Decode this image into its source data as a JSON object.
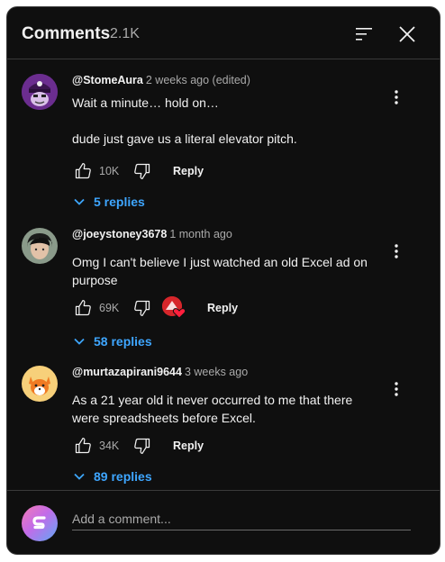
{
  "header": {
    "title": "Comments",
    "count": "2.1K"
  },
  "comments": [
    {
      "author": "@StomeAura",
      "time": "2 weeks ago (edited)",
      "lines": [
        "Wait a minute… hold on…",
        "",
        "dude just gave us a literal elevator pitch."
      ],
      "likes": "10K",
      "reply_label": "Reply",
      "replies_label": "5 replies",
      "creator_heart": false
    },
    {
      "author": "@joeystoney3678",
      "time": "1 month ago",
      "lines": [
        "Omg I can't believe I just watched an old Excel ad on purpose"
      ],
      "likes": "69K",
      "reply_label": "Reply",
      "replies_label": "58 replies",
      "creator_heart": true
    },
    {
      "author": "@murtazapirani9644",
      "time": "3 weeks ago",
      "lines": [
        "As a 21 year old it never occurred to me that there were spreadsheets before Excel."
      ],
      "likes": "34K",
      "reply_label": "Reply",
      "replies_label": "89 replies",
      "creator_heart": false
    }
  ],
  "footer": {
    "placeholder": "Add a comment..."
  },
  "colors": {
    "background": "#0f0f0f",
    "link": "#3ea6ff",
    "heart": "#d6262b"
  },
  "icons": [
    "sort-icon",
    "close-icon",
    "more-vert-icon",
    "thumb-up-icon",
    "thumb-down-icon",
    "chevron-down-icon",
    "heart-icon"
  ]
}
